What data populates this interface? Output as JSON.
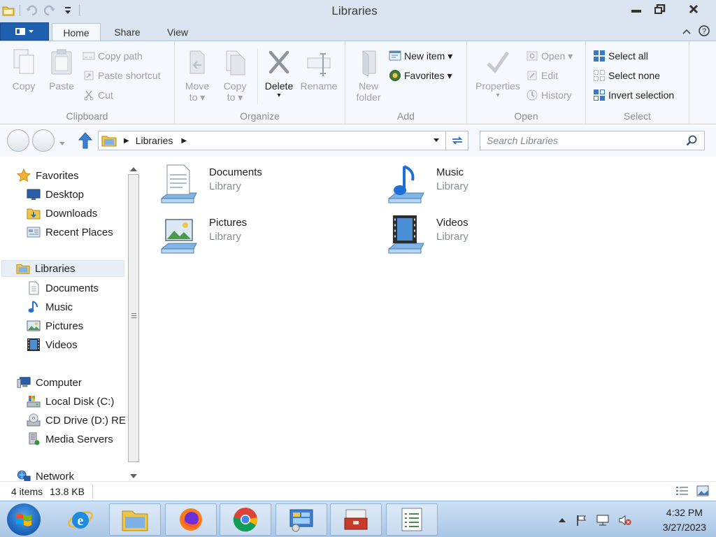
{
  "window": {
    "title": "Libraries",
    "controls": {
      "minimize": "—",
      "maximize": "□",
      "close": "X"
    }
  },
  "ribbon": {
    "tabs": [
      "Home",
      "Share",
      "View"
    ],
    "active_tab": "Home",
    "clipboard": {
      "label": "Clipboard",
      "copy": "Copy",
      "paste": "Paste",
      "copy_path": "Copy path",
      "paste_shortcut": "Paste shortcut",
      "cut": "Cut"
    },
    "organize": {
      "label": "Organize",
      "move_to_1": "Move",
      "move_to_2": "to ▾",
      "copy_to_1": "Copy",
      "copy_to_2": "to ▾",
      "delete": "Delete",
      "delete_arrow": "▾",
      "rename": "Rename"
    },
    "add": {
      "label": "Add",
      "new_folder_1": "New",
      "new_folder_2": "folder",
      "new_item": "New item ▾",
      "favorites": "Favorites ▾"
    },
    "open": {
      "label": "Open",
      "properties": "Properties",
      "properties_arrow": "▾",
      "open": "Open ▾",
      "edit": "Edit",
      "history": "History"
    },
    "select": {
      "label": "Select",
      "select_all": "Select all",
      "select_none": "Select none",
      "invert_selection": "Invert selection"
    }
  },
  "address_bar": {
    "crumb_sep": "▶",
    "path": "Libraries",
    "search_placeholder": "Search Libraries"
  },
  "nav": {
    "favorites": "Favorites",
    "desktop": "Desktop",
    "downloads": "Downloads",
    "recent_places": "Recent Places",
    "libraries": "Libraries",
    "documents": "Documents",
    "music": "Music",
    "pictures": "Pictures",
    "videos": "Videos",
    "computer": "Computer",
    "local_disk": "Local Disk (C:)",
    "cd_drive": "CD Drive (D:) RED",
    "media_servers": "Media Servers",
    "network": "Network"
  },
  "libraries": [
    {
      "name": "Documents",
      "type": "Library"
    },
    {
      "name": "Music",
      "type": "Library"
    },
    {
      "name": "Pictures",
      "type": "Library"
    },
    {
      "name": "Videos",
      "type": "Library"
    }
  ],
  "status": {
    "items": "4 items",
    "size": "13.8 KB"
  },
  "clock": {
    "time": "4:32 PM",
    "date": "3/27/2023"
  },
  "colors": {
    "accent": "#1f5fb0",
    "taskbar": "#b8d1ec",
    "ribbon": "#f5f8fc"
  }
}
